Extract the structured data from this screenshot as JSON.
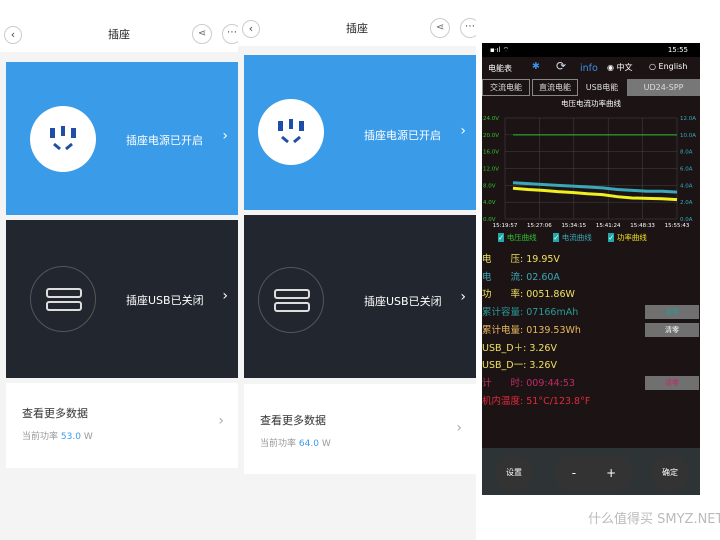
{
  "panels": [
    {
      "title": "插座",
      "socket_label": "插座电源已开启",
      "usb_label": "插座USB已关闭",
      "more_label": "查看更多数据",
      "power_prefix": "当前功率",
      "power_value": "53.0",
      "power_unit": "W"
    },
    {
      "title": "插座",
      "socket_label": "插座电源已开启",
      "usb_label": "插座USB已关闭",
      "more_label": "查看更多数据",
      "power_prefix": "当前功率",
      "power_value": "64.0",
      "power_unit": "W"
    }
  ],
  "meter": {
    "status_time": "15:55",
    "app_title": "电能表",
    "info_label": "info",
    "lang_cn": "中文",
    "lang_en": "English",
    "lang_selected": "中文",
    "tabs": [
      "交流电能",
      "直流电能",
      "USB电能",
      "UD24-SPP"
    ],
    "active_tab": "USB电能",
    "readings": [
      {
        "label": "电　　压:",
        "value": "19.95V",
        "color": "#f0e060"
      },
      {
        "label": "电　　流:",
        "value": "02.60A",
        "color": "#3aa8b8"
      },
      {
        "label": "功　　率:",
        "value": "0051.86W",
        "color": "#f0e060"
      },
      {
        "label": "累计容量:",
        "value": "07166mAh",
        "color": "#2a9a9a",
        "clear": "清零"
      },
      {
        "label": "累计电量:",
        "value": "0139.53Wh",
        "color": "#e8b860",
        "clear": "清零"
      },
      {
        "label": "USB_D＋:",
        "value": "3.26V",
        "color": "#f0e060"
      },
      {
        "label": "USB_D一:",
        "value": "3.26V",
        "color": "#f0e060"
      },
      {
        "label": "计　　时:",
        "value": "009:44:53",
        "color": "#c02a6a",
        "clear": "清零"
      },
      {
        "label": "机内温度:",
        "value": "51°C/123.8°F",
        "color": "#e02a3a"
      }
    ],
    "buttons": {
      "settings": "设置",
      "minus": "-",
      "plus": "+",
      "confirm": "确定"
    },
    "legend": [
      "电压曲线",
      "电流曲线",
      "功率曲线"
    ]
  },
  "chart_data": {
    "type": "line",
    "title": "电压电流功率曲线",
    "x_ticks": [
      "15:19:57",
      "15:27:06",
      "15:34:15",
      "15:41:24",
      "15:48:33",
      "15:55:43"
    ],
    "y_left_ticks": [
      "0.0V",
      "4.0V",
      "8.0V",
      "12.0V",
      "16.0V",
      "20.0V",
      "24.0V"
    ],
    "y_right_ticks": [
      "0.0A",
      "2.0A",
      "4.0A",
      "6.0A",
      "8.0A",
      "10.0A",
      "12.0A"
    ],
    "ylim_left": [
      0,
      24
    ],
    "ylim_right": [
      0,
      12
    ],
    "grid": true,
    "series": [
      {
        "name": "电压曲线",
        "axis": "left",
        "color": "#2ec42e",
        "values": [
          20,
          20,
          20,
          20,
          20,
          20,
          20,
          20,
          20,
          20,
          20,
          20
        ]
      },
      {
        "name": "电流曲线",
        "axis": "right",
        "color": "#3aa8b8",
        "values": [
          4.3,
          4.2,
          4.1,
          4.0,
          3.9,
          3.8,
          3.7,
          3.5,
          3.4,
          3.3,
          3.3,
          3.2
        ]
      },
      {
        "name": "功率曲线",
        "axis": "left",
        "color": "#f0f020",
        "values": [
          7.3,
          7.0,
          6.8,
          6.5,
          6.3,
          6.0,
          5.8,
          5.3,
          5.0,
          4.9,
          4.8,
          4.6
        ]
      }
    ]
  },
  "watermark": "什么值得买 SMYZ.NET"
}
